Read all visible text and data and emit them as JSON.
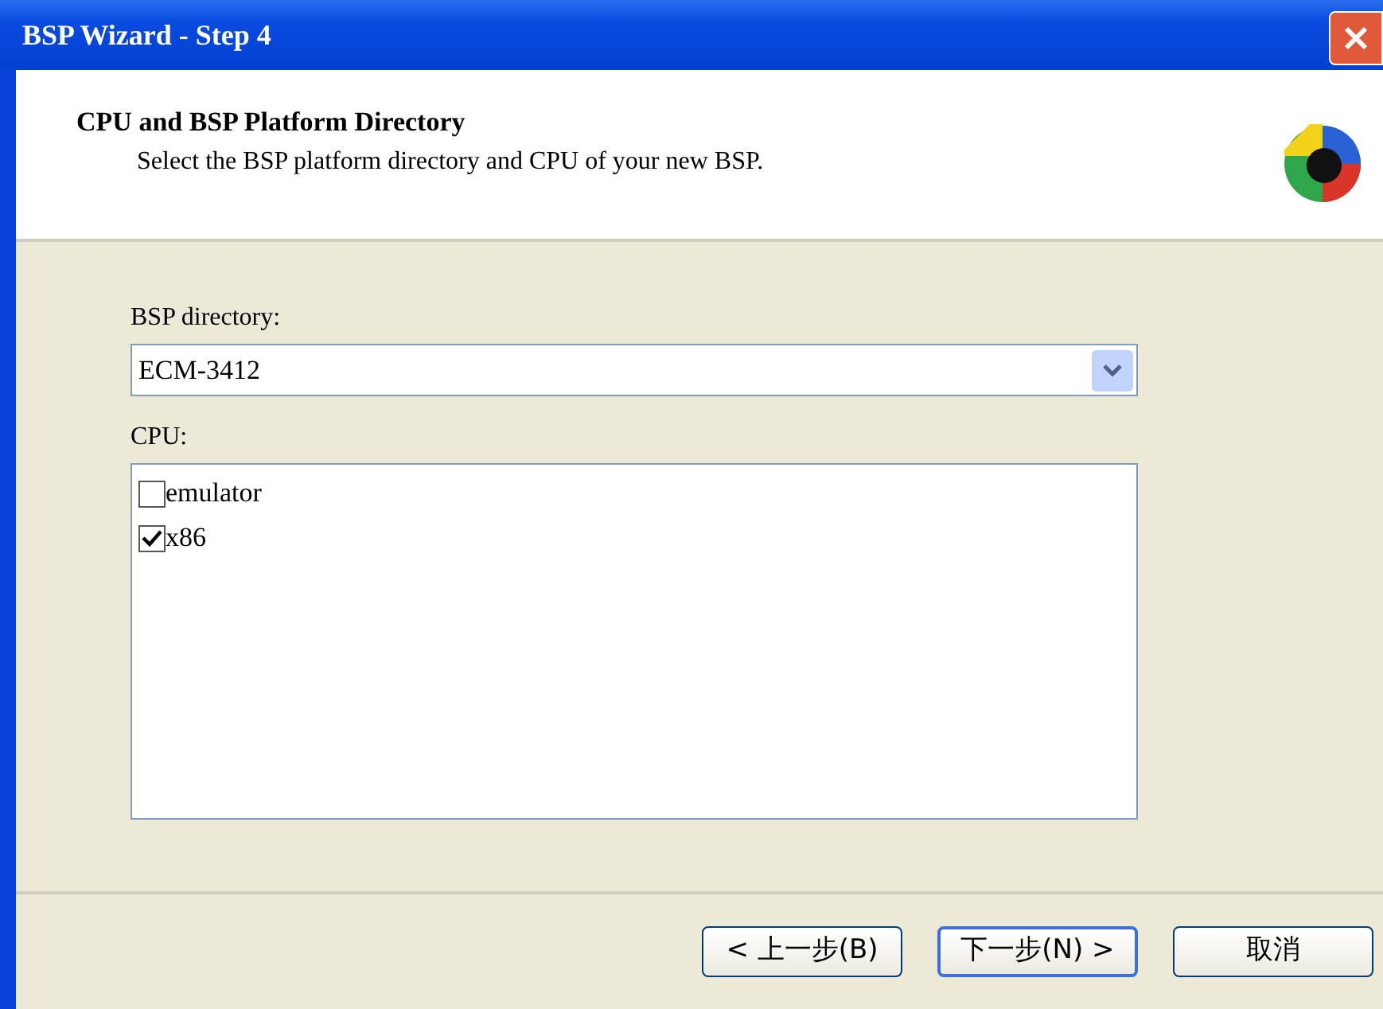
{
  "window": {
    "title": "BSP Wizard - Step 4"
  },
  "header": {
    "title": "CPU and BSP Platform Directory",
    "subtitle": "Select the BSP platform directory and CPU of your new BSP."
  },
  "bsp_directory": {
    "label": "BSP directory:",
    "value": "ECM-3412"
  },
  "cpu": {
    "label": "CPU:",
    "items": [
      {
        "label": "emulator",
        "checked": false
      },
      {
        "label": "x86",
        "checked": true
      }
    ]
  },
  "buttons": [
    {
      "label": "< 上一步(B)",
      "default": false
    },
    {
      "label": "下一步(N) >",
      "default": true
    },
    {
      "label": "取消",
      "default": false
    }
  ]
}
